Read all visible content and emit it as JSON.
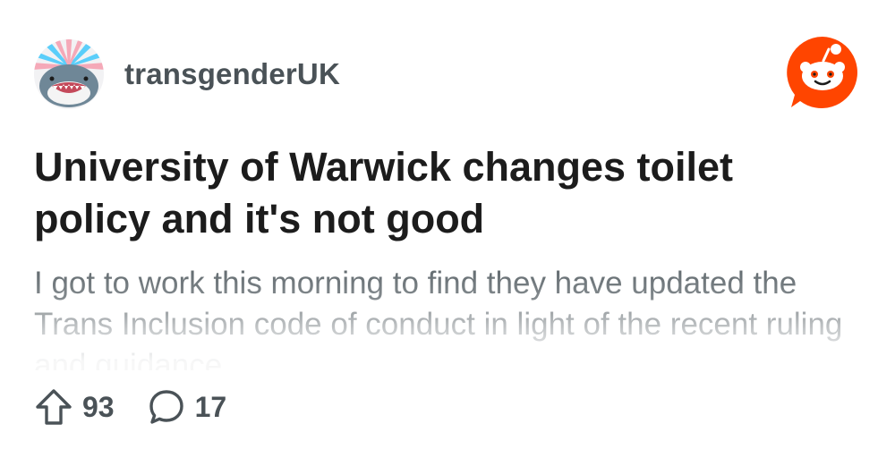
{
  "post": {
    "subreddit": "transgenderUK",
    "title": "University of Warwick changes toilet policy and it's not good",
    "body": "I got to work this morning to find they have updated the Trans Inclusion code of conduct in light of the recent ruling and guidance",
    "upvotes": "93",
    "comments": "17"
  },
  "icons": {
    "avatar": "shark-avatar-with-trans-flag-icon",
    "brand": "reddit-logo-icon",
    "upvote": "upvote-arrow-icon",
    "comment": "comment-bubble-icon"
  },
  "colors": {
    "reddit_orange": "#ff4500",
    "trans_blue": "#5bcefa",
    "trans_pink": "#f5a9b8",
    "text_primary": "#1c1c1c",
    "text_secondary": "#5b6469"
  }
}
